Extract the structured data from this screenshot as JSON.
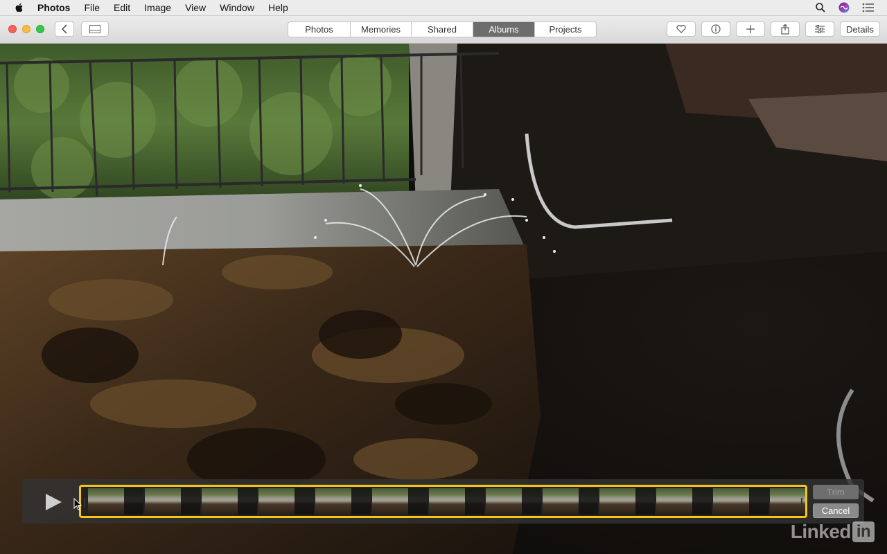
{
  "menubar": {
    "app_name": "Photos",
    "items": [
      "File",
      "Edit",
      "Image",
      "View",
      "Window",
      "Help"
    ],
    "right_icons": [
      "search-icon",
      "siri-icon",
      "notification-center-icon"
    ]
  },
  "toolbar": {
    "tabs": [
      {
        "label": "Photos",
        "active": false
      },
      {
        "label": "Memories",
        "active": false
      },
      {
        "label": "Shared",
        "active": false
      },
      {
        "label": "Albums",
        "active": true
      },
      {
        "label": "Projects",
        "active": false
      }
    ],
    "icons": [
      "back-icon",
      "sidebar-icon",
      "heart-icon",
      "info-icon",
      "add-icon",
      "share-icon",
      "adjust-icon"
    ],
    "details_label": "Details"
  },
  "trim": {
    "trim_label": "Trim",
    "cancel_label": "Cancel",
    "frame_count": 13
  },
  "watermark": {
    "text": "Linked",
    "badge": "in"
  },
  "colors": {
    "accent_yellow": "#f5c518",
    "active_tab": "#6d6d6d"
  }
}
